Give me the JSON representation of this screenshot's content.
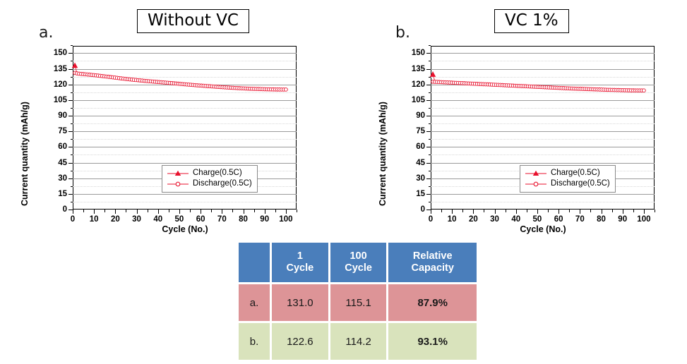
{
  "panels": [
    {
      "label": "a.",
      "title": "Without VC",
      "axes": {
        "y_title": "Current quantity (mAh/g)",
        "x_title": "Cycle (No.)",
        "y_ticks": [
          "0",
          "15",
          "30",
          "45",
          "60",
          "75",
          "90",
          "105",
          "120",
          "135",
          "150"
        ],
        "x_ticks": [
          "0",
          "10",
          "20",
          "30",
          "40",
          "50",
          "60",
          "70",
          "80",
          "90",
          "100"
        ]
      },
      "legend": [
        {
          "name": "charge",
          "label": "Charge(0.5C)",
          "marker": "filled-triangle",
          "color": "#e8112d"
        },
        {
          "name": "discharge",
          "label": "Discharge(0.5C)",
          "marker": "open-circle",
          "color": "#e8112d"
        }
      ]
    },
    {
      "label": "b.",
      "title": "VC 1%",
      "axes": {
        "y_title": "Current quantity (mAh/g)",
        "x_title": "Cycle (No.)",
        "y_ticks": [
          "0",
          "15",
          "30",
          "45",
          "60",
          "75",
          "90",
          "105",
          "120",
          "135",
          "150"
        ],
        "x_ticks": [
          "0",
          "10",
          "20",
          "30",
          "40",
          "50",
          "60",
          "70",
          "80",
          "90",
          "100"
        ]
      },
      "legend": [
        {
          "name": "charge",
          "label": "Charge(0.5C)",
          "marker": "filled-triangle",
          "color": "#e8112d"
        },
        {
          "name": "discharge",
          "label": "Discharge(0.5C)",
          "marker": "open-circle",
          "color": "#e8112d"
        }
      ]
    }
  ],
  "table": {
    "header": [
      "",
      "1\nCycle",
      "100\nCycle",
      "Relative\nCapacity"
    ],
    "header_cells": {
      "blank": "",
      "c1": "1",
      "c1b": "Cycle",
      "c2": "100",
      "c2b": "Cycle",
      "c3": "Relative",
      "c3b": "Capacity"
    },
    "rows": [
      {
        "label": "a.",
        "cycle1": "131.0",
        "cycle100": "115.1",
        "relative": "87.9%",
        "bg": "#dd9497"
      },
      {
        "label": "b.",
        "cycle1": "122.6",
        "cycle100": "114.2",
        "relative": "93.1%",
        "bg": "#d9e3bc"
      }
    ]
  },
  "colors": {
    "header_blue": "#4a7ebb",
    "row_a": "#dd9497",
    "row_b": "#d9e3bc",
    "series_red": "#e8112d",
    "grid": "#9b9b9b"
  },
  "chart_data": [
    {
      "type": "line",
      "title": "Without VC",
      "panel": "a",
      "xlabel": "Cycle (No.)",
      "ylabel": "Current quantity (mAh/g)",
      "xlim": [
        0,
        105
      ],
      "ylim": [
        0,
        157
      ],
      "xticks": [
        0,
        10,
        20,
        30,
        40,
        50,
        60,
        70,
        80,
        90,
        100
      ],
      "yticks": [
        0,
        15,
        30,
        45,
        60,
        75,
        90,
        105,
        120,
        135,
        150
      ],
      "grid": true,
      "legend_position": "lower-center-right",
      "series": [
        {
          "name": "Charge(0.5C)",
          "marker": "filled-triangle",
          "color": "#e8112d",
          "x": [
            1,
            2,
            3,
            4,
            5,
            6,
            7,
            8,
            9,
            10,
            12,
            14,
            16,
            18,
            20,
            22,
            24,
            26,
            28,
            30,
            34,
            38,
            42,
            46,
            50,
            54,
            58,
            62,
            66,
            70,
            74,
            78,
            82,
            86,
            90,
            94,
            98,
            100
          ],
          "y": [
            138.0,
            131.2,
            130.8,
            130.6,
            130.4,
            130.2,
            130.0,
            129.8,
            129.6,
            129.4,
            129.0,
            128.6,
            128.1,
            127.6,
            127.1,
            126.6,
            126.1,
            125.6,
            125.1,
            124.7,
            123.9,
            123.2,
            122.5,
            121.8,
            121.1,
            120.4,
            119.7,
            119.0,
            118.4,
            117.8,
            117.2,
            116.7,
            116.3,
            115.9,
            115.6,
            115.3,
            115.2,
            115.1
          ]
        },
        {
          "name": "Discharge(0.5C)",
          "marker": "open-circle",
          "color": "#e8112d",
          "x": [
            1,
            2,
            3,
            4,
            5,
            6,
            7,
            8,
            9,
            10,
            12,
            14,
            16,
            18,
            20,
            22,
            24,
            26,
            28,
            30,
            34,
            38,
            42,
            46,
            50,
            54,
            58,
            62,
            66,
            70,
            74,
            78,
            82,
            86,
            90,
            94,
            98,
            100
          ],
          "y": [
            131.0,
            130.6,
            130.3,
            130.1,
            129.9,
            129.7,
            129.5,
            129.3,
            129.1,
            128.9,
            128.5,
            128.0,
            127.5,
            127.0,
            126.5,
            126.0,
            125.5,
            125.0,
            124.6,
            124.2,
            123.4,
            122.7,
            122.0,
            121.3,
            120.6,
            119.9,
            119.2,
            118.6,
            118.0,
            117.4,
            116.9,
            116.4,
            116.0,
            115.7,
            115.4,
            115.2,
            115.1,
            115.1
          ]
        }
      ]
    },
    {
      "type": "line",
      "title": "VC 1%",
      "panel": "b",
      "xlabel": "Cycle (No.)",
      "ylabel": "Current quantity (mAh/g)",
      "xlim": [
        0,
        105
      ],
      "ylim": [
        0,
        157
      ],
      "xticks": [
        0,
        10,
        20,
        30,
        40,
        50,
        60,
        70,
        80,
        90,
        100
      ],
      "yticks": [
        0,
        15,
        30,
        45,
        60,
        75,
        90,
        105,
        120,
        135,
        150
      ],
      "grid": true,
      "legend_position": "lower-center-right",
      "series": [
        {
          "name": "Charge(0.5C)",
          "marker": "filled-triangle",
          "color": "#e8112d",
          "x": [
            1,
            2,
            3,
            4,
            5,
            6,
            7,
            8,
            9,
            10,
            12,
            14,
            16,
            18,
            20,
            22,
            24,
            26,
            28,
            30,
            34,
            38,
            42,
            46,
            50,
            54,
            58,
            62,
            66,
            70,
            74,
            78,
            82,
            86,
            90,
            94,
            98,
            100
          ],
          "y": [
            129.5,
            123.0,
            122.9,
            122.8,
            122.7,
            122.6,
            122.5,
            122.4,
            122.3,
            122.2,
            122.0,
            121.8,
            121.6,
            121.4,
            121.2,
            121.0,
            120.8,
            120.6,
            120.4,
            120.2,
            119.8,
            119.4,
            119.0,
            118.6,
            118.2,
            117.8,
            117.4,
            117.0,
            116.6,
            116.2,
            115.8,
            115.5,
            115.2,
            114.9,
            114.7,
            114.5,
            114.3,
            114.2
          ]
        },
        {
          "name": "Discharge(0.5C)",
          "marker": "open-circle",
          "color": "#e8112d",
          "x": [
            1,
            2,
            3,
            4,
            5,
            6,
            7,
            8,
            9,
            10,
            12,
            14,
            16,
            18,
            20,
            22,
            24,
            26,
            28,
            30,
            34,
            38,
            42,
            46,
            50,
            54,
            58,
            62,
            66,
            70,
            74,
            78,
            82,
            86,
            90,
            94,
            98,
            100
          ],
          "y": [
            122.6,
            122.5,
            122.4,
            122.3,
            122.2,
            122.1,
            122.0,
            121.9,
            121.8,
            121.7,
            121.5,
            121.3,
            121.1,
            120.9,
            120.7,
            120.5,
            120.3,
            120.1,
            119.9,
            119.7,
            119.3,
            118.9,
            118.5,
            118.1,
            117.7,
            117.3,
            116.9,
            116.5,
            116.1,
            115.8,
            115.5,
            115.2,
            114.9,
            114.7,
            114.5,
            114.3,
            114.2,
            114.2
          ]
        }
      ]
    }
  ]
}
